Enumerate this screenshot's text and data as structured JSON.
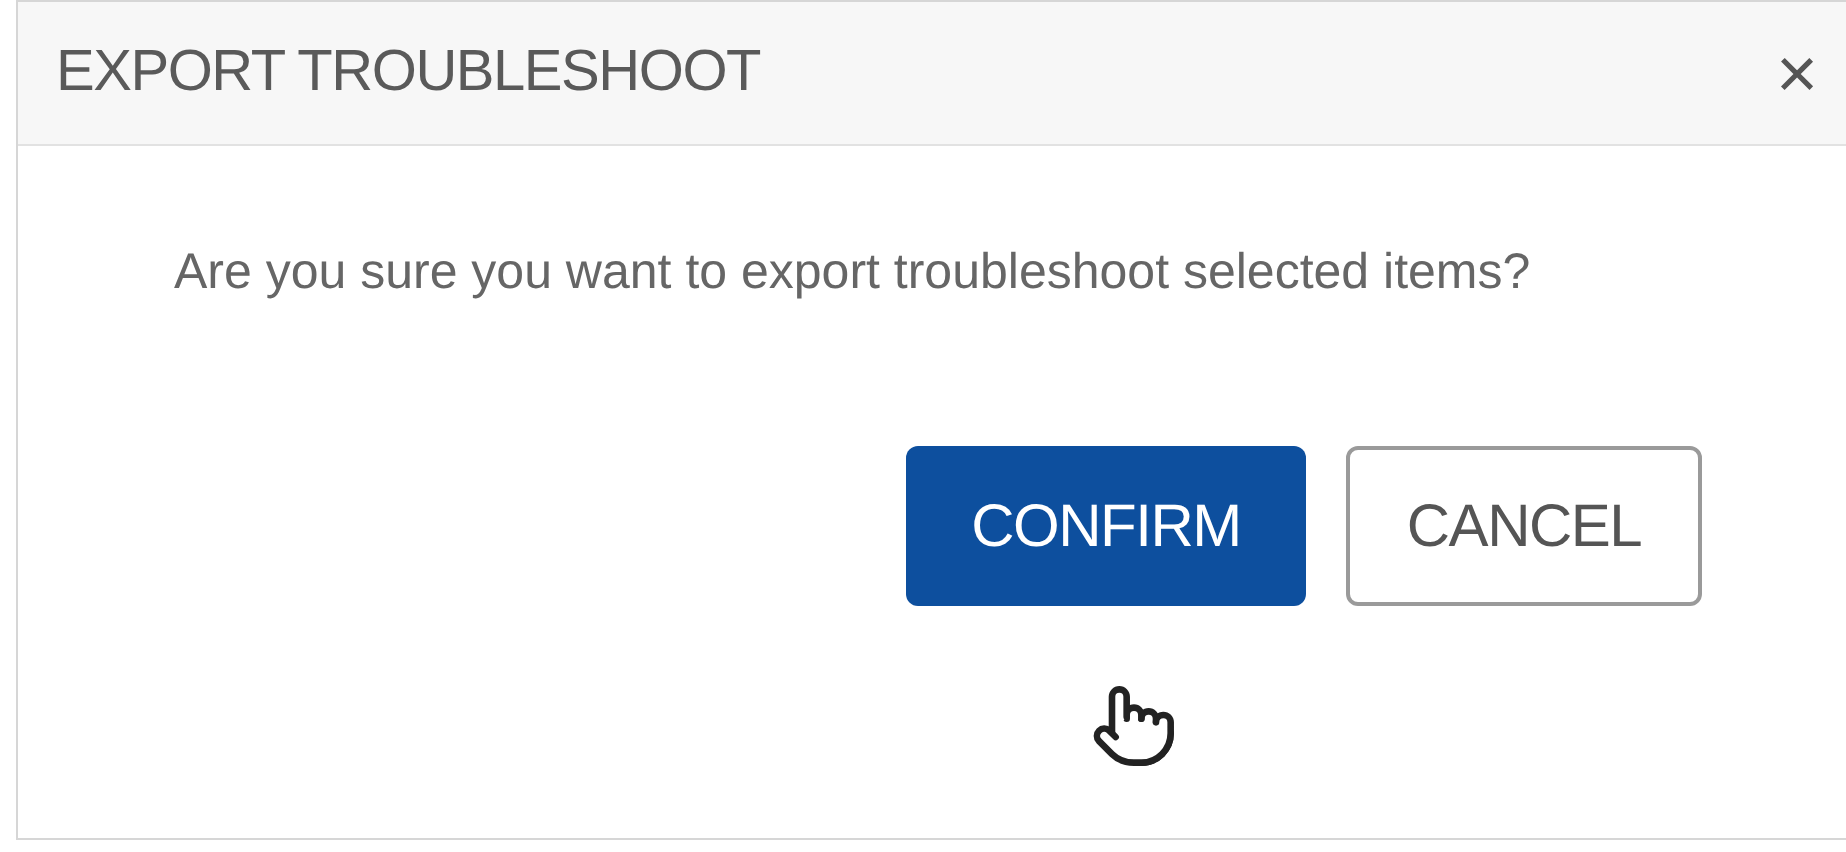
{
  "dialog": {
    "title": "EXPORT TROUBLESHOOT",
    "close": "×",
    "message": "Are you sure you want to export troubleshoot selected items?",
    "buttons": [
      {
        "label": "CONFIRM",
        "kind": "primary"
      },
      {
        "label": "CANCEL",
        "kind": "secondary"
      }
    ]
  }
}
